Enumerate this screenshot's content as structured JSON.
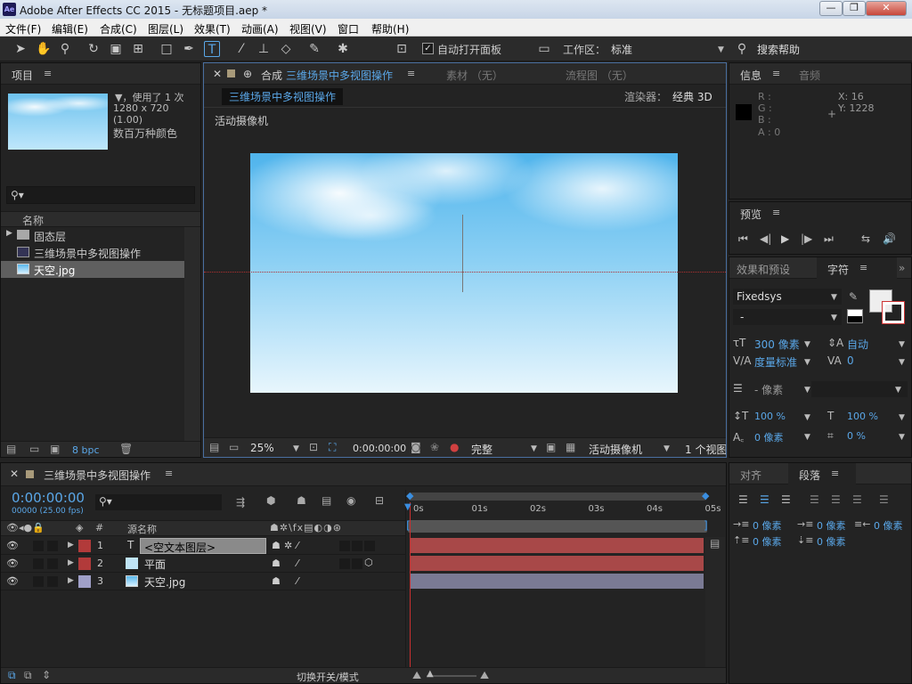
{
  "window": {
    "title": "Adobe After Effects CC 2015 - 无标题项目.aep *",
    "logo": "Ae",
    "min": "—",
    "max": "❐",
    "close": "✕"
  },
  "menu": [
    "文件(F)",
    "编辑(E)",
    "合成(C)",
    "图层(L)",
    "效果(T)",
    "动画(A)",
    "视图(V)",
    "窗口",
    "帮助(H)"
  ],
  "toolbar": {
    "auto_open_label": "自动打开面板",
    "workspace_label": "工作区：",
    "workspace_value": "标准",
    "search_help": "搜索帮助"
  },
  "project": {
    "tab": "项目",
    "used_label": "▼，使用了 1 次",
    "dimensions": "1280 x 720 (1.00)",
    "colors": "数百万种颜色",
    "search_placeholder": "",
    "column_name": "名称",
    "items": [
      {
        "name": "固态层",
        "type": "folder"
      },
      {
        "name": "三维场景中多视图操作",
        "type": "composition"
      },
      {
        "name": "天空.jpg",
        "type": "image"
      }
    ],
    "bpc": "8 bpc"
  },
  "composition_viewer": {
    "tab_prefix": "合成",
    "tab_name": "三维场景中多视图操作",
    "footage_tab": "素材 （无）",
    "flow_tab": "流程图 （无）",
    "comp_chip": "三维场景中多视图操作",
    "renderer_label": "渲染器：",
    "renderer_value": "经典 3D",
    "camera_label": "活动摄像机",
    "zoom": "25%",
    "timecode": "0:00:00:00",
    "quality": "完整",
    "camera_view": "活动摄像机",
    "views": "1 个视图"
  },
  "info": {
    "tab": "信息",
    "audio_tab": "音频",
    "r": "R :",
    "g": "G :",
    "b": "B :",
    "a": "A : 0",
    "x": "X: 16",
    "y": "Y: 1228"
  },
  "preview": {
    "tab": "预览"
  },
  "character": {
    "effects_tab": "效果和预设",
    "char_tab": "字符",
    "font": "Fixedsys",
    "style": "-",
    "size": "300 像素",
    "leading": "自动",
    "kerning": "度量标准",
    "tracking": "0",
    "stroke": "- 像素",
    "vscale": "100 %",
    "hscale": "100 %",
    "baseline": "0 像素",
    "tsume": "0 %"
  },
  "paragraph": {
    "align_tab": "对齐",
    "para_tab": "段落",
    "indent_left": "0 像素",
    "indent_first": "0 像素",
    "indent_right": "0 像素",
    "space_before": "0 像素",
    "space_after": "0 像素"
  },
  "timeline": {
    "comp_name": "三维场景中多视图操作",
    "timecode": "0:00:00:00",
    "fps": "00000 (25.00 fps)",
    "col_hash": "#",
    "col_source": "源名称",
    "ruler": [
      "0s",
      "01s",
      "02s",
      "03s",
      "04s",
      "05s"
    ],
    "layers": [
      {
        "num": "1",
        "name": "<空文本图层>",
        "color": "#b23a3a",
        "bar": "#a84848"
      },
      {
        "num": "2",
        "name": "平面",
        "color": "#b23a3a",
        "bar": "#a84848"
      },
      {
        "num": "3",
        "name": "天空.jpg",
        "color": "#a0a0c8",
        "bar": "#7a7a94"
      }
    ],
    "toggle_label": "切换开关/模式"
  }
}
